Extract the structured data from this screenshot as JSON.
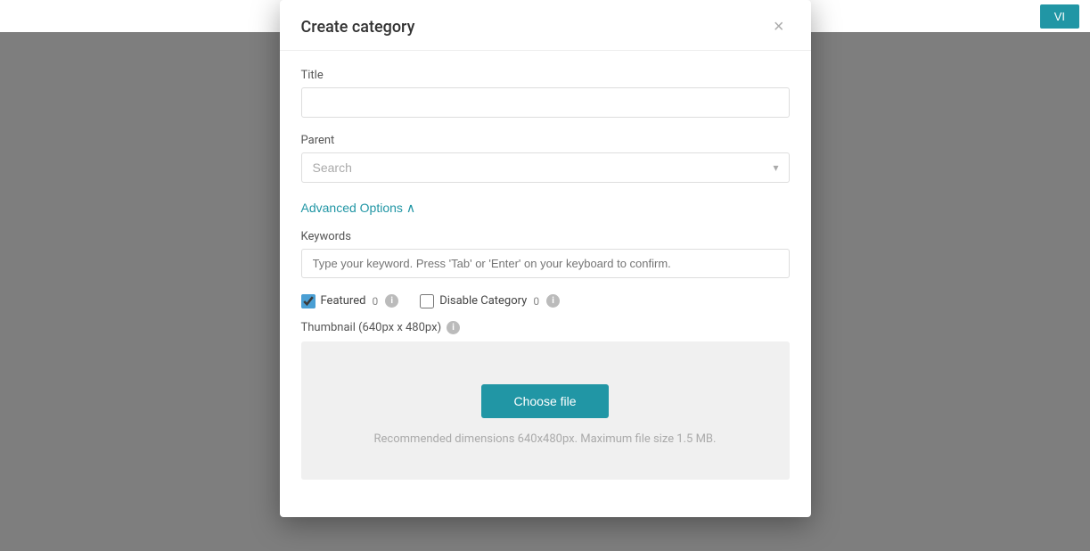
{
  "background_button": "VI",
  "modal": {
    "title": "Create category",
    "close_label": "×",
    "fields": {
      "title_label": "Title",
      "title_placeholder": "",
      "parent_label": "Parent",
      "parent_placeholder": "Search",
      "keywords_label": "Keywords",
      "keywords_placeholder": "Type your keyword. Press 'Tab' or 'Enter' on your keyboard to confirm."
    },
    "advanced_options_label": "Advanced Options",
    "advanced_options_chevron": "^",
    "checkboxes": {
      "featured_label": "Featured",
      "featured_count": "0",
      "featured_checked": true,
      "disable_category_label": "Disable Category",
      "disable_category_count": "0",
      "disable_category_checked": false
    },
    "thumbnail": {
      "label": "Thumbnail (640px x 480px)",
      "choose_file_label": "Choose file",
      "hint": "Recommended dimensions 640x480px. Maximum file size 1.5 MB."
    }
  }
}
